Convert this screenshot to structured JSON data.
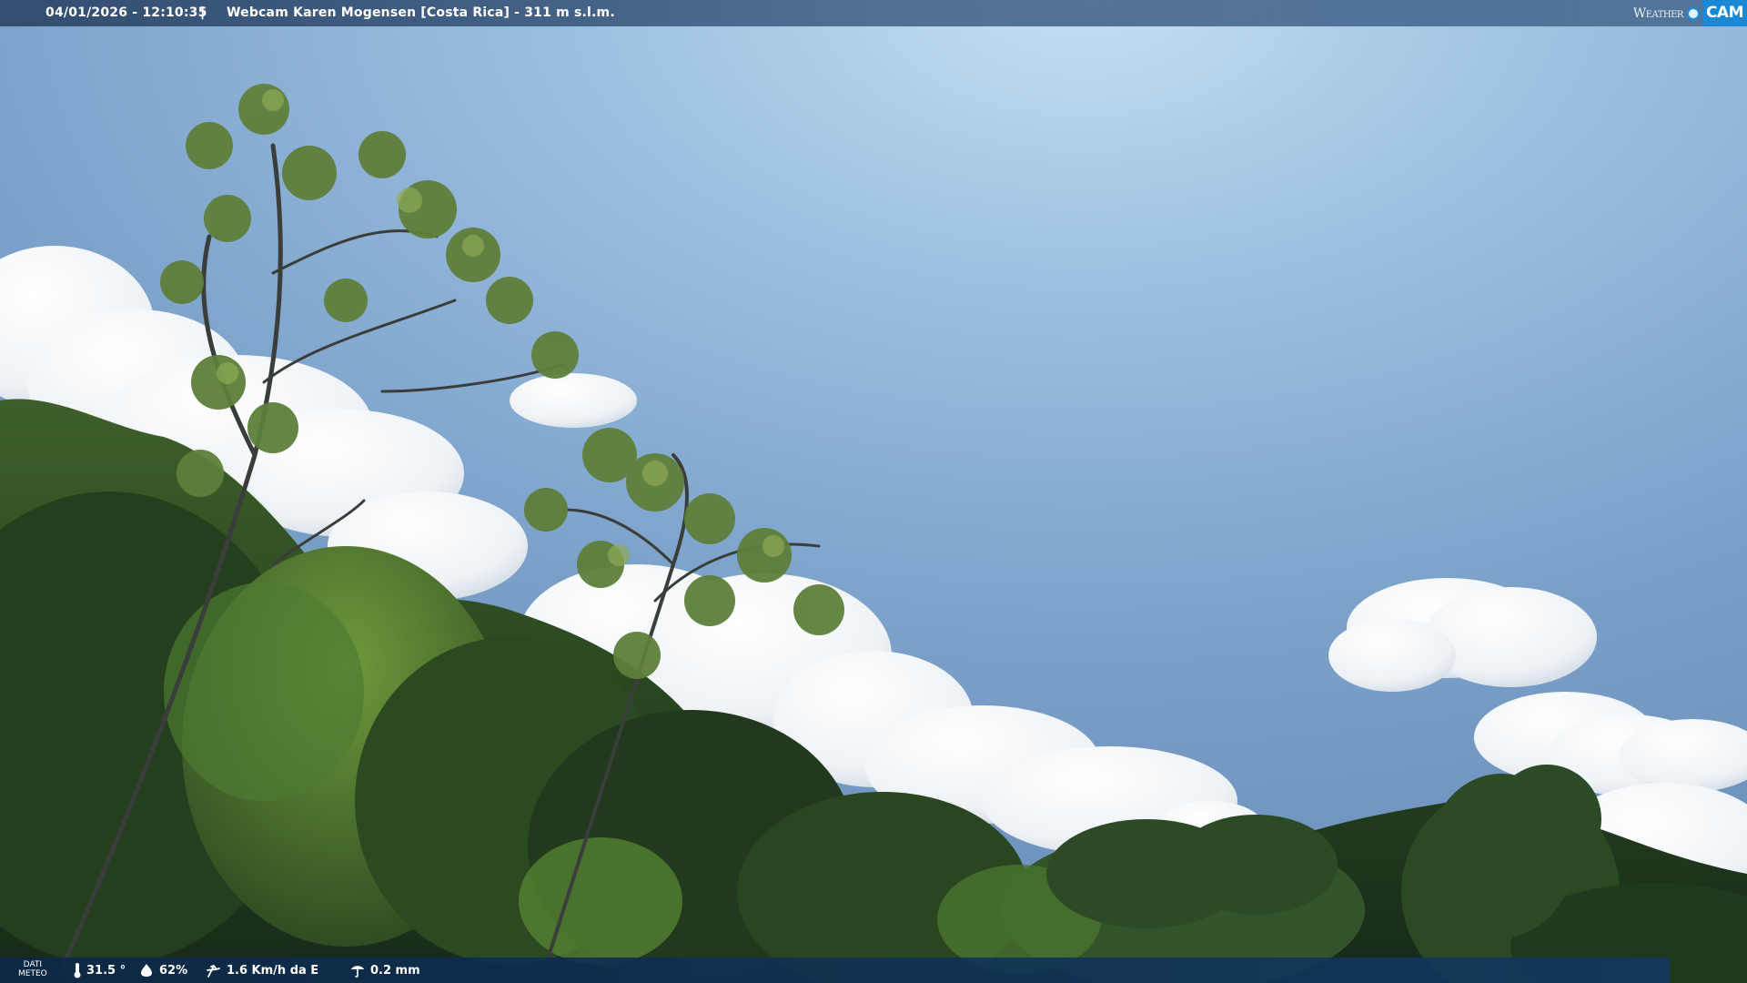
{
  "topbar": {
    "datetime": "04/01/2026 - 12:10:35",
    "separator": "|",
    "title": "Webcam Karen Mogensen [Costa Rica]  - 311 m s.l.m."
  },
  "brand": {
    "word": "Weather",
    "cam": "CAM"
  },
  "meteo": {
    "label_line1": "DATI",
    "label_line2": "METEO",
    "temperature": "31.5 °",
    "humidity": "62%",
    "wind": "1.6 Km/h da E",
    "rain": "0.2 mm"
  },
  "colors": {
    "sky_top": "#9cc0df",
    "sky_mid": "#6f97c2",
    "foliage_dark": "#1f3a1c",
    "foliage_light": "#6c8f3a",
    "brand_blue": "#1a88d4"
  },
  "icons": {
    "temperature": "thermometer-icon",
    "humidity": "humidity-icon",
    "wind": "wind-icon",
    "rain": "rain-icon"
  }
}
